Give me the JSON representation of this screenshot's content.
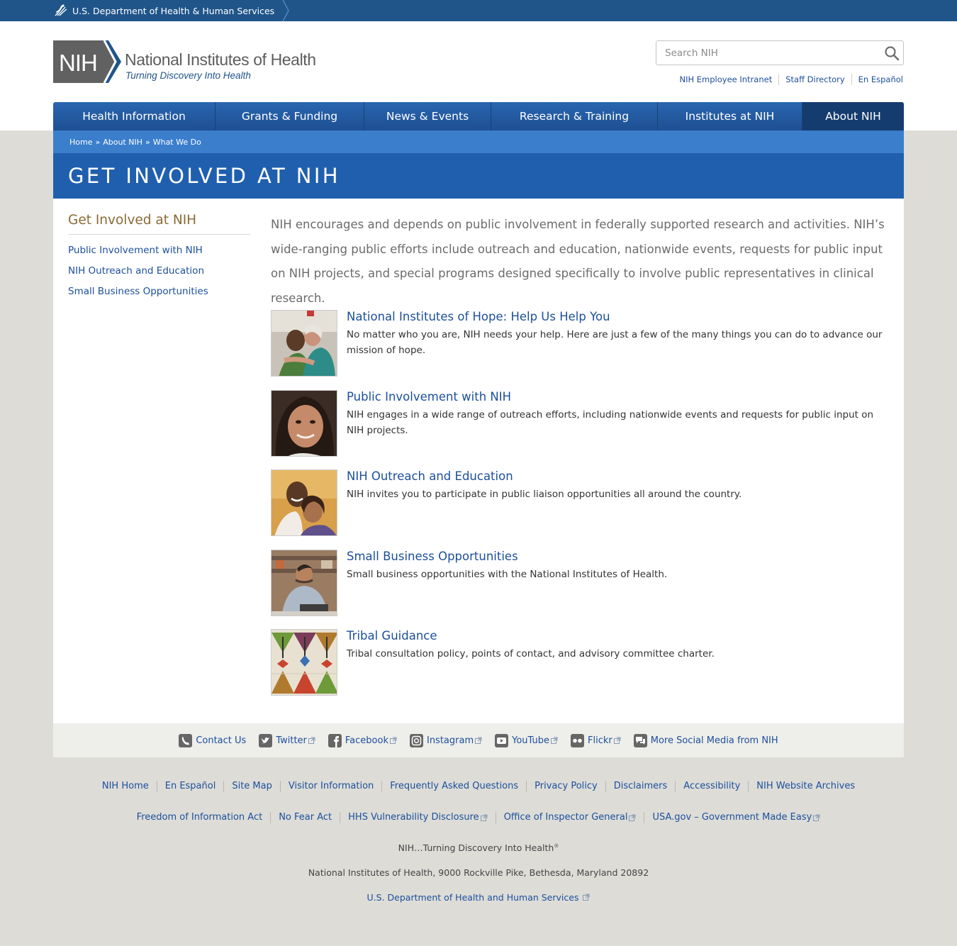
{
  "hhs": {
    "label": "U.S. Department of Health & Human Services"
  },
  "logo": {
    "abbr": "NIH",
    "name": "National Institutes of Health",
    "tagline": "Turning Discovery Into Health"
  },
  "search": {
    "placeholder": "Search NIH"
  },
  "utility_links": [
    "NIH Employee Intranet",
    "Staff Directory",
    "En Español"
  ],
  "nav": [
    "Health Information",
    "Grants & Funding",
    "News & Events",
    "Research & Training",
    "Institutes at NIH",
    "About NIH"
  ],
  "breadcrumb": [
    "Home",
    "About NIH",
    "What We Do"
  ],
  "breadcrumb_sep": "»",
  "page_title": "GET INVOLVED AT NIH",
  "sidebar": {
    "title": "Get Involved at NIH",
    "links": [
      "Public Involvement with NIH",
      "NIH Outreach and Education",
      "Small Business Opportunities"
    ]
  },
  "intro": "NIH encourages and depends on public involvement in federally supported research and activities. NIH’s wide-ranging public efforts include outreach and education, nationwide events, requests for public input on NIH projects, and special programs designed specifically to involve public representatives in clinical research.",
  "entries": [
    {
      "title": "National Institutes of Hope: Help Us Help You",
      "desc": "No matter who you are, NIH needs your help. Here are just a few of the many things you can do to advance our mission of hope."
    },
    {
      "title": "Public Involvement with NIH",
      "desc": "NIH engages in a wide range of outreach efforts, including nationwide events and requests for public input on NIH projects."
    },
    {
      "title": "NIH Outreach and Education",
      "desc": "NIH invites you to participate in public liaison opportunities all around the country."
    },
    {
      "title": "Small Business Opportunities",
      "desc": "Small business opportunities with the National Institutes of Health."
    },
    {
      "title": "Tribal Guidance",
      "desc": "Tribal consultation policy, points of contact, and advisory committee charter."
    }
  ],
  "social": [
    "Contact Us",
    "Twitter",
    "Facebook",
    "Instagram",
    "YouTube",
    "Flickr",
    "More Social Media from NIH"
  ],
  "footer_row1": [
    "NIH Home",
    "En Español",
    "Site Map",
    "Visitor Information",
    "Frequently Asked Questions",
    "Privacy Policy",
    "Disclaimers",
    "Accessibility",
    "NIH Website Archives"
  ],
  "footer_row2": [
    "Freedom of Information Act",
    "No Fear Act",
    "HHS Vulnerability Disclosure",
    "Office of Inspector General",
    "USA.gov – Government Made Easy"
  ],
  "footer_tagline": "NIH…Turning Discovery Into Health",
  "footer_tm": "®",
  "footer_address": "National Institutes of Health, 9000 Rockville Pike, Bethesda, Maryland 20892",
  "footer_hhs": "U.S. Department of Health and Human Services",
  "colors": {
    "hhs_bar": "#20558a",
    "nav": "#1d4f92",
    "nav_active": "#153c6e",
    "breadcrumb": "#3a7ecc",
    "title_band": "#205fae",
    "link": "#1c4f9c",
    "sidebar_title": "#8a6a35"
  }
}
